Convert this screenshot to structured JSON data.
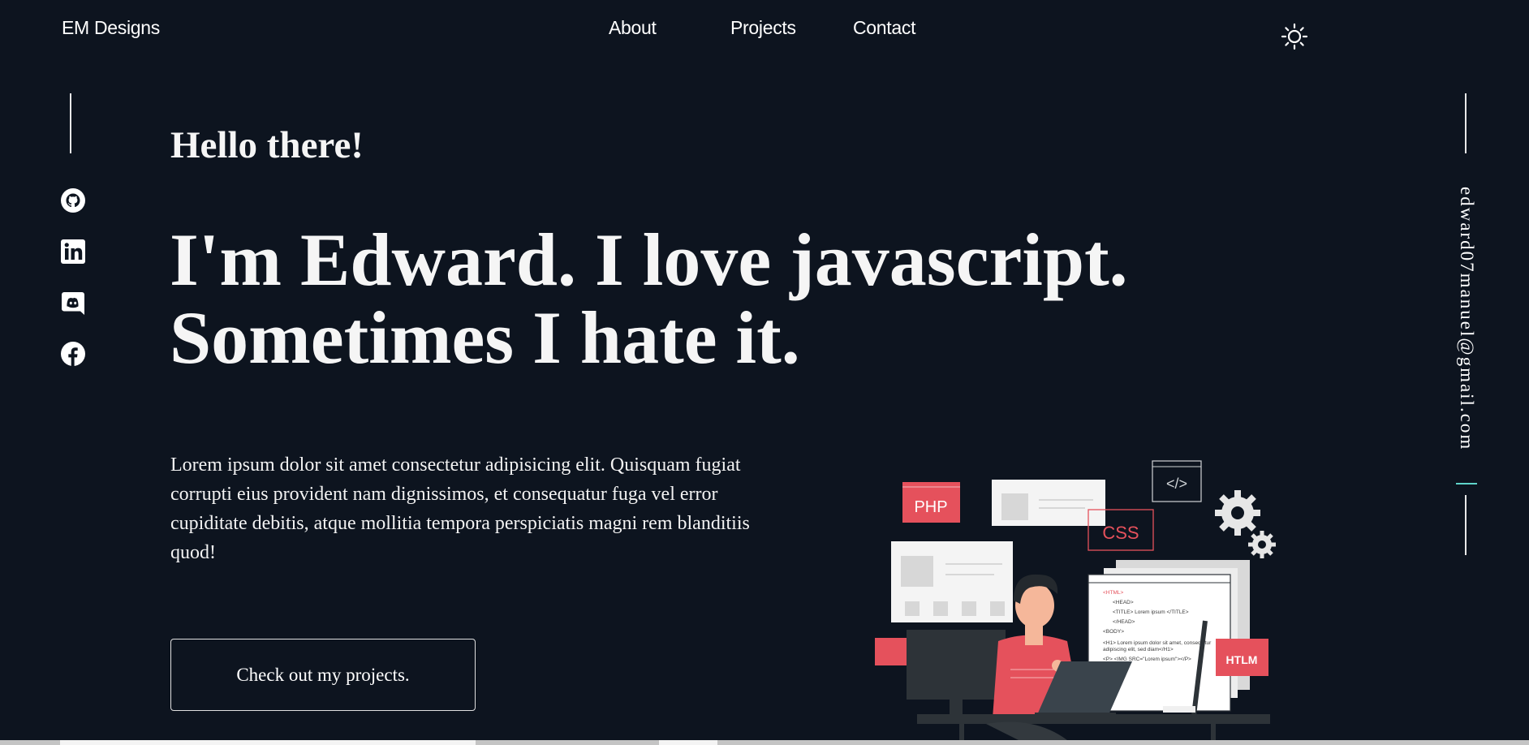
{
  "header": {
    "brand": "EM Designs",
    "nav": {
      "about": "About",
      "projects": "Projects",
      "contact": "Contact"
    },
    "theme_toggle_icon": "sun-icon"
  },
  "social": {
    "icons": [
      "github-icon",
      "linkedin-icon",
      "discord-icon",
      "facebook-icon"
    ]
  },
  "email": "edward07manuel@gmail.com",
  "hero": {
    "greeting": "Hello there!",
    "headline_line1": "I'm Edward. I love javascript.",
    "headline_line2": "Sometimes I hate it.",
    "intro": "Lorem ipsum dolor sit amet consectetur adipisicing elit. Quisquam fugiat corrupti eius provident nam dignissimos, et consequatur fuga vel error cupiditate debitis, atque mollitia tempora perspiciatis magni rem blanditiis quod!",
    "cta": "Check out my projects."
  },
  "illustration": {
    "php_label": "PHP",
    "css_label": "CSS",
    "htlm_label": "HTLM",
    "code_lines": [
      "<HTML>",
      "<HEAD>",
      "<TITLE> Lorem ipsum </TITLE>",
      "</HEAD>",
      "<BODY>",
      "<H1> Lorem ipsum dolor sit amet, consectetur",
      "adipiscing elit, sed diam</H1>",
      "<P> <IMG SRC=\"Lorem ipsum\"></P>"
    ]
  },
  "colors": {
    "background": "#0d141f",
    "accent": "#5fd4c9",
    "illustration_red": "#e5515c"
  }
}
